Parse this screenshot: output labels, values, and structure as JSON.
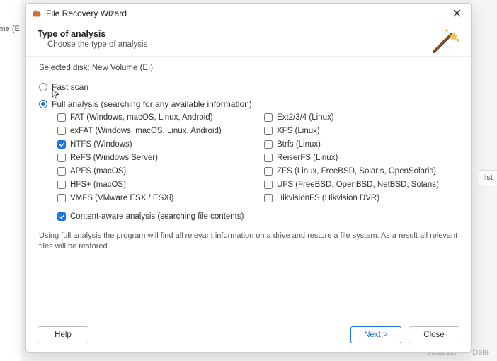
{
  "background": {
    "volume_label": "lume (E:",
    "right_snippet": "list",
    "bottom_buttons": [
      "Recover",
      "Dele"
    ]
  },
  "titlebar": {
    "title": "File Recovery Wizard"
  },
  "header": {
    "title": "Type of analysis",
    "subtitle": "Choose the type of analysis"
  },
  "selected_disk": {
    "label": "Selected disk:",
    "value": "New Volume (E:)"
  },
  "options": {
    "fast_scan": {
      "label": "Fast scan",
      "selected": false
    },
    "full_analysis": {
      "label": "Full analysis (searching for any available information)",
      "selected": true
    }
  },
  "filesystems_left": [
    {
      "label": "FAT (Windows, macOS, Linux, Android)",
      "checked": false
    },
    {
      "label": "exFAT (Windows, macOS, Linux, Android)",
      "checked": false
    },
    {
      "label": "NTFS (Windows)",
      "checked": true
    },
    {
      "label": "ReFS (Windows Server)",
      "checked": false
    },
    {
      "label": "APFS (macOS)",
      "checked": false
    },
    {
      "label": "HFS+ (macOS)",
      "checked": false
    },
    {
      "label": "VMFS (VMware ESX / ESXi)",
      "checked": false
    }
  ],
  "filesystems_right": [
    {
      "label": "Ext2/3/4 (Linux)",
      "checked": false
    },
    {
      "label": "XFS (Linux)",
      "checked": false
    },
    {
      "label": "Btrfs (Linux)",
      "checked": false
    },
    {
      "label": "ReiserFS (Linux)",
      "checked": false
    },
    {
      "label": "ZFS (Linux, FreeBSD, Solaris, OpenSolaris)",
      "checked": false
    },
    {
      "label": "UFS (FreeBSD, OpenBSD, NetBSD, Solaris)",
      "checked": false
    },
    {
      "label": "HikvisionFS (Hikvision DVR)",
      "checked": false
    }
  ],
  "content_aware": {
    "label": "Content-aware analysis (searching file contents)",
    "checked": true
  },
  "description": "Using full analysis the program will find all relevant information on a drive and restore a file system. As a result all relevant files will be restored.",
  "footer": {
    "help": "Help",
    "next": "Next >",
    "close": "Close"
  },
  "colors": {
    "accent": "#1a73e8"
  }
}
